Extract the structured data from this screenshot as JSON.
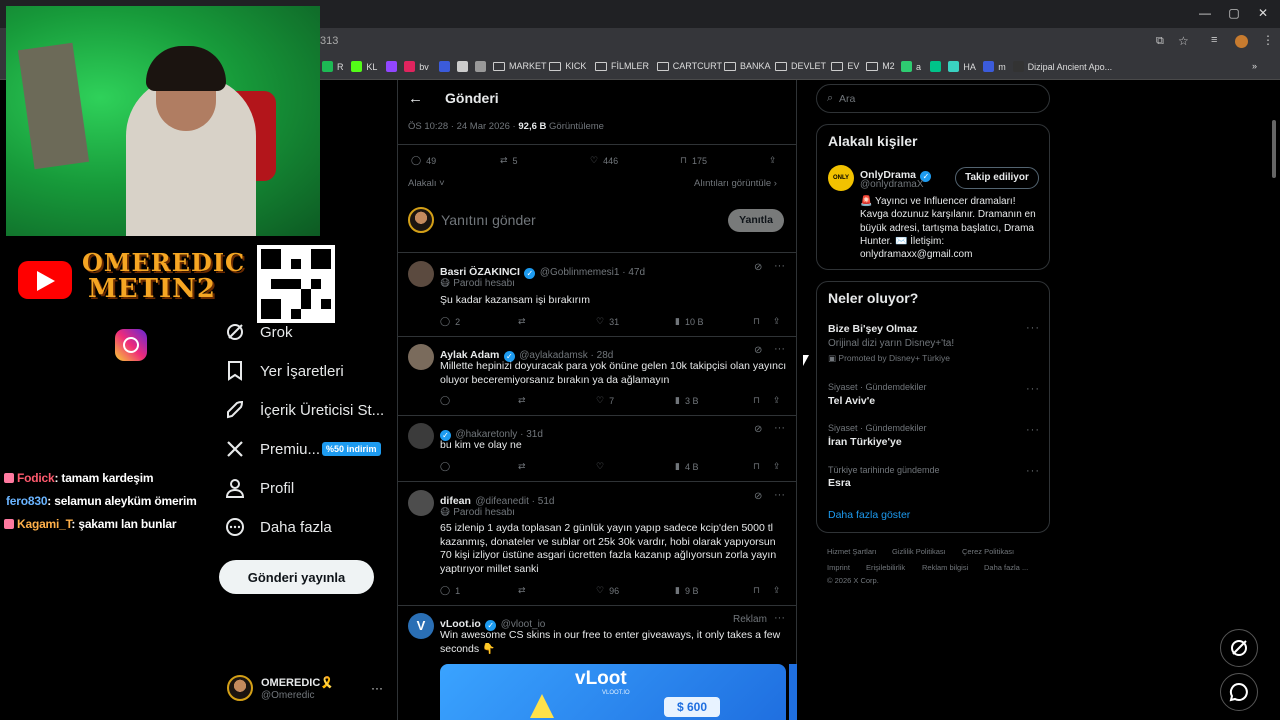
{
  "browser": {
    "url_fragment": "313",
    "bookmarks": [
      {
        "label": "R",
        "color": "#1db954"
      },
      {
        "label": "KL",
        "color": "#53fc18"
      },
      {
        "label": "",
        "color": "#9146ff"
      },
      {
        "label": "bv",
        "color": "#e0245e"
      },
      {
        "label": "",
        "color": "#3b5bdb"
      },
      {
        "label": "",
        "color": "#cccccc"
      },
      {
        "label": "",
        "color": "#999999"
      },
      {
        "label": "MARKET",
        "folder": true
      },
      {
        "label": "KICK",
        "folder": true
      },
      {
        "label": "FİLMLER",
        "folder": true
      },
      {
        "label": "CARTCURT",
        "folder": true
      },
      {
        "label": "BANKA",
        "folder": true
      },
      {
        "label": "DEVLET",
        "folder": true
      },
      {
        "label": "EV",
        "folder": true
      },
      {
        "label": "M2",
        "folder": true
      },
      {
        "label": "a",
        "color": "#2ecc71"
      },
      {
        "label": "",
        "color": "#00c389"
      },
      {
        "label": "HA",
        "color": "#3ad1c1"
      },
      {
        "label": "m",
        "color": "#3b5bdb"
      },
      {
        "label": "Dizipal Ancient Apo...",
        "color": "#333333"
      }
    ]
  },
  "overlay": {
    "brand_line1": "OMEREDIC",
    "brand_line2": "METIN2",
    "chat": [
      {
        "user": "Fodick",
        "text": ": tamam kardeşim"
      },
      {
        "user": "fero830",
        "text": ": selamun aleyküm ömerim"
      },
      {
        "user": "Kagami_T",
        "text": ": şakamı lan bunlar"
      }
    ]
  },
  "nav": {
    "items": [
      {
        "label": "Grok",
        "icon": "grok-icon"
      },
      {
        "label": "Yer İşaretleri",
        "icon": "bookmark-icon"
      },
      {
        "label": "İçerik Üreticisi St...",
        "icon": "rocket-icon"
      },
      {
        "label": "Premiu...",
        "icon": "x-logo-icon"
      },
      {
        "label": "Profil",
        "icon": "profile-icon"
      },
      {
        "label": "Daha fazla",
        "icon": "more-icon"
      }
    ],
    "promo_badge": "%50 indirim",
    "post_button": "Gönderi yayınla",
    "account_name": "OMEREDIC🎗️",
    "account_handle": "@Omeredic"
  },
  "post": {
    "header_title": "Gönderi",
    "time": "ÖS 10:28 · 24 Mar 2026 · ",
    "views_count": "92,6 B",
    "views_label": "Görüntüleme",
    "replies": "49",
    "reposts": "5",
    "likes": "446",
    "bookmarks": "175",
    "sort_label": "Alakalı",
    "quotes_link": "Alıntıları görüntüle",
    "reply_placeholder": "Yanıtını gönder",
    "reply_button": "Yanıtla"
  },
  "replies": [
    {
      "name": "Basri ÖZAKINCI",
      "handle": "@Goblinmemesi1 · 47d",
      "parodi": "Parodi hesabı",
      "text": "Şu kadar kazansam işi bırakırım",
      "replies": "2",
      "reposts": "",
      "likes": "31",
      "views": "10 B"
    },
    {
      "name": "Aylak Adam",
      "handle": "@aylakadamsk · 28d",
      "parodi": "",
      "text": "Millette hepinizi doyuracak para yok önüne gelen 10k takipçisi olan yayıncı oluyor beceremiyorsanız bırakın ya da ağlamayın",
      "replies": "",
      "reposts": "",
      "likes": "7",
      "views": "3 B"
    },
    {
      "name": "",
      "handle": "@hakaretonly · 31d",
      "parodi": "",
      "text": "bu kim ve olay ne",
      "replies": "",
      "reposts": "",
      "likes": "",
      "views": "4 B"
    },
    {
      "name": "difean",
      "handle": "@difeanedit · 51d",
      "parodi": "Parodi hesabı",
      "text": "65 izlenip 1 ayda toplasan 2 günlük yayın yapıp sadece kcip'den 5000 tl kazanmış, donateler ve sublar ort 25k 30k vardır, hobi olarak yapıyorsun 70 kişi izliyor üstüne asgari ücretten fazla kazanıp ağlıyorsun zorla yayın yaptırıyor millet sanki",
      "replies": "1",
      "reposts": "",
      "likes": "96",
      "views": "9 B"
    },
    {
      "name": "vLoot.io",
      "handle": "@vloot_io",
      "ad_label": "Reklam",
      "text": "Win awesome CS skins in our free to enter giveaways, it only takes a few seconds 👇",
      "ad_brand": "vLoot",
      "ad_sub": "VLOOT.IO",
      "ad_price": "$ 600"
    }
  ],
  "sidebar": {
    "search_placeholder": "Ara",
    "relevant_title": "Alakalı kişiler",
    "person_name": "OnlyDrama",
    "person_handle": "@onlydramaX",
    "follow_button": "Takip ediliyor",
    "person_bio": "🚨 Yayıncı ve Influencer dramaları! Kavga dozunuz karşılanır. Dramanın en büyük adresi, tartışma başlatıcı, Drama Hunter. ✉️ İletişim: onlydramaxx@gmail.com",
    "trends_title": "Neler oluyor?",
    "trends": [
      {
        "meta": "",
        "title": "Bize Bi'şey Olmaz",
        "sub": "Orijinal dizi yarın Disney+'ta!",
        "promo": "Promoted by Disney+ Türkiye"
      },
      {
        "meta": "Siyaset · Gündemdekiler",
        "title": "Tel Aviv'e"
      },
      {
        "meta": "Siyaset · Gündemdekiler",
        "title": "İran Türkiye'ye"
      },
      {
        "meta": "Türkiye tarihinde gündemde",
        "title": "Esra"
      }
    ],
    "show_more": "Daha fazla göster",
    "footer": [
      "Hizmet Şartları",
      "Gizlilik Politikası",
      "Çerez Politikası",
      "Imprint",
      "Erişilebilirlik",
      "Reklam bilgisi",
      "Daha fazla ...",
      "© 2026 X Corp."
    ]
  },
  "colors": {
    "accent": "#1d9bf0",
    "bg": "#000000",
    "border": "#2f3336",
    "muted": "#71767b"
  }
}
